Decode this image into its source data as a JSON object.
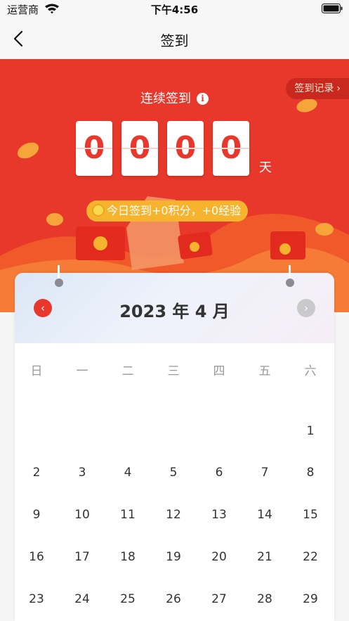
{
  "status_bar": {
    "carrier": "运营商",
    "time": "下午4:56",
    "wifi_icon": "wifi-icon",
    "battery_icon": "battery-icon"
  },
  "nav": {
    "back_icon": "chevron-left-icon",
    "title": "签到"
  },
  "hero": {
    "records_label": "签到记录",
    "streak_label": "连续签到",
    "info_icon": "info-icon",
    "digits": [
      "0",
      "0",
      "0",
      "0"
    ],
    "days_unit": "天",
    "bonus_text": "今日签到+0积分，+0经验"
  },
  "calendar": {
    "month_title": "2023 年 4 月",
    "prev_icon": "chevron-left-icon",
    "next_icon": "chevron-right-icon",
    "weekdays": [
      "日",
      "一",
      "二",
      "三",
      "四",
      "五",
      "六"
    ],
    "weeks": [
      [
        "",
        "",
        "",
        "",
        "",
        "",
        "1"
      ],
      [
        "2",
        "3",
        "4",
        "5",
        "6",
        "7",
        "8"
      ],
      [
        "9",
        "10",
        "11",
        "12",
        "13",
        "14",
        "15"
      ],
      [
        "16",
        "17",
        "18",
        "19",
        "20",
        "21",
        "22"
      ],
      [
        "23",
        "24",
        "25",
        "26",
        "27",
        "28",
        "29"
      ]
    ]
  },
  "colors": {
    "brand_red": "#e8372b",
    "coin_gold": "#f6b32d",
    "disabled_gray": "#c9c9cc"
  }
}
